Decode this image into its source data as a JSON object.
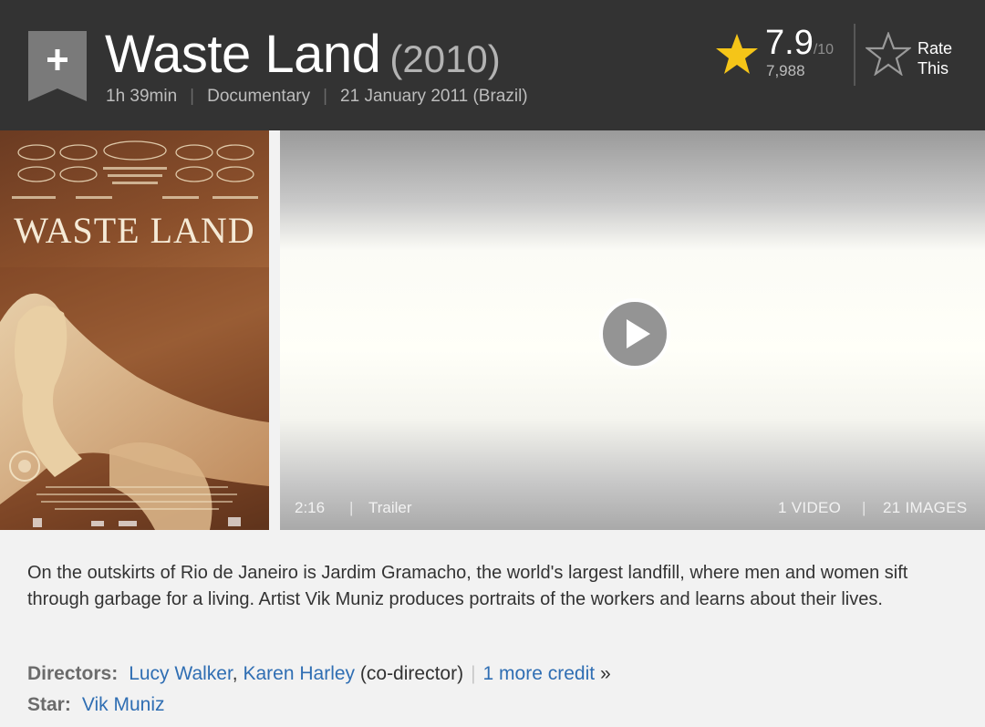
{
  "header": {
    "title": "Waste Land",
    "year": "(2010)",
    "runtime": "1h 39min",
    "genre": "Documentary",
    "release": "21 January 2011 (Brazil)",
    "separator": "|",
    "watchlist_icon": "plus-ribbon-icon",
    "rating": {
      "value": "7.9",
      "max": "/10",
      "count": "7,988",
      "star_icon": "star-filled-icon",
      "star_color": "#f5c518"
    },
    "rate": {
      "label_line1": "Rate",
      "label_line2": "This",
      "icon": "star-outline-icon"
    }
  },
  "poster": {
    "title": "WASTE LAND"
  },
  "video": {
    "duration": "2:16",
    "separator": "|",
    "type": "Trailer",
    "video_count": "1 VIDEO",
    "image_count": "21 IMAGES",
    "play_icon": "play-icon"
  },
  "summary": {
    "plot": "On the outskirts of Rio de Janeiro is Jardim Gramacho, the world's largest landfill, where men and women sift through garbage for a living. Artist Vik Muniz produces portraits of the workers and learns about their lives.",
    "directors_label": "Directors:",
    "director1": "Lucy Walker",
    "comma": ",",
    "director2": "Karen Harley",
    "director2_role": "(co-director)",
    "pipe": "|",
    "more_credit": "1 more credit",
    "more_arrow": "»",
    "star_label": "Star:",
    "star1": "Vik Muniz",
    "link_color": "#2f6eb3"
  }
}
